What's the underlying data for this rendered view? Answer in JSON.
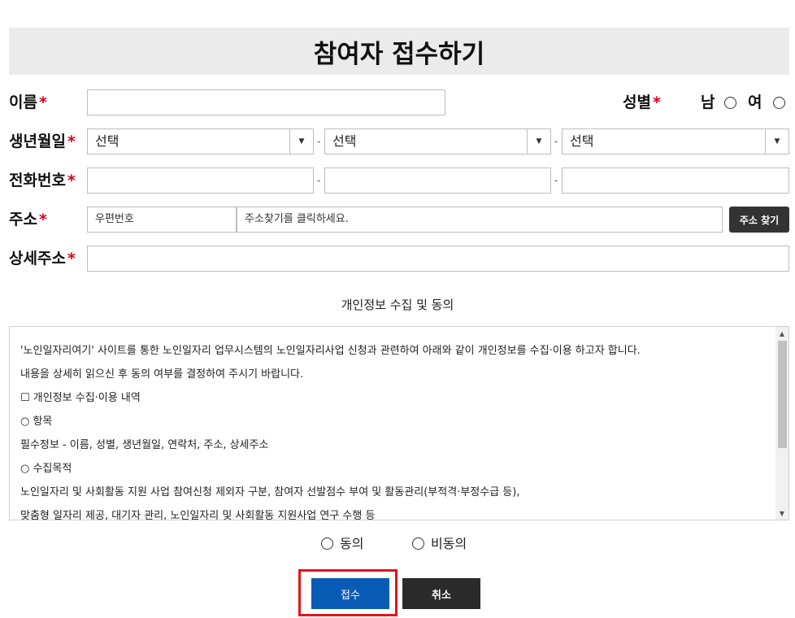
{
  "header": {
    "title": "참여자 접수하기"
  },
  "required_mark": "*",
  "form": {
    "name_label": "이름",
    "gender_label": "성별",
    "gender_male": "남",
    "gender_female": "여",
    "birth_label": "생년월일",
    "birth_year": "선택",
    "birth_month": "선택",
    "birth_day": "선택",
    "phone_label": "전화번호",
    "address_label": "주소",
    "zip_placeholder": "우편번호",
    "address_placeholder": "주소찾기를 클릭하세요.",
    "find_address_button": "주소 찾기",
    "detail_label": "상세주소",
    "separator": "-"
  },
  "privacy": {
    "title": "개인정보 수집 및 동의",
    "lines": [
      "'노인일자리여기' 사이트를 통한 노인일자리 업무시스템의 노인일자리사업 신청과 관련하여 아래와 같이 개인정보를 수집·이용 하고자 합니다.",
      "내용을 상세히 읽으신 후 동의 여부를 결정하여 주시기 바랍니다.",
      "☐ 개인정보 수집·이용 내역",
      "○ 항목",
      "필수정보 - 이름, 성별, 생년월일, 연락처, 주소, 상세주소",
      "○ 수집목적",
      "노인일자리 및 사회활동 지원 사업 참여신청 제외자 구분, 참여자 선발점수 부여 및 활동관리(부적격·부정수급 등),",
      "맞춤형 일자리 제공, 대기자 관리, 노인일자리 및 사회활동 지원사업 연구 수행 등"
    ],
    "agree": "동의",
    "disagree": "비동의"
  },
  "actions": {
    "submit": "접수",
    "cancel": "취소"
  },
  "colors": {
    "required": "#d6001c",
    "submit_bg": "#0a5bb5",
    "cancel_bg": "#2b2b2b",
    "highlight": "#e5141a"
  }
}
